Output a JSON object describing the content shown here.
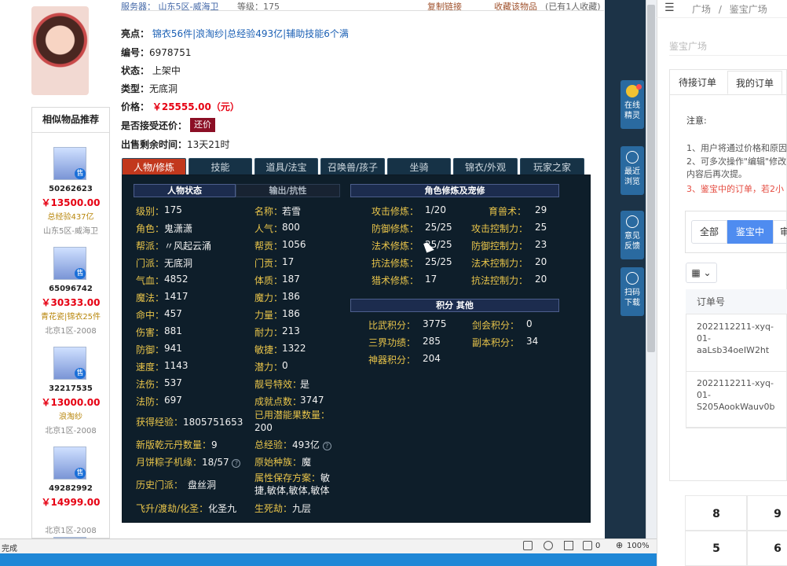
{
  "header_row": {
    "server_label": "服务器：",
    "server_value": "山东5区-威海卫",
    "rank_fragment": "等级：175",
    "link1": "复制链接",
    "link2": "收藏该物品",
    "link3": "(已有1人收藏)"
  },
  "item": {
    "highlight_label": "亮点：",
    "highlights": [
      "锦衣56件",
      "浪淘纱",
      "总经验493亿",
      "辅助技能6个满"
    ],
    "id_label": "编号：",
    "id_value": "6978751",
    "status_label": "状态：",
    "status_value": "上架中",
    "type_label": "类型：",
    "type_value": "无底洞",
    "price_label": "价格：",
    "price_value": "￥25555.00（元）",
    "counter_label": "是否接受还价：",
    "counter_button": "还价",
    "remain_label": "出售剩余时间：",
    "remain_value": "13天21时"
  },
  "tabs": [
    {
      "label": "人物/修炼"
    },
    {
      "label": "技能"
    },
    {
      "label": "道具/法宝"
    },
    {
      "label": "召唤兽/孩子"
    },
    {
      "label": "坐骑"
    },
    {
      "label": "锦衣/外观"
    },
    {
      "label": "玩家之家"
    }
  ],
  "panel": {
    "subtab_left": "人物状态",
    "subtab_right": "输出/抗性",
    "stats_left": [
      {
        "k": "级别：",
        "v": "175"
      },
      {
        "k": "角色：",
        "v": "鬼潇潇"
      },
      {
        "k": "帮派：",
        "v": "〃风起云涌"
      },
      {
        "k": "门派：",
        "v": "无底洞"
      },
      {
        "k": "气血：",
        "v": "4852"
      },
      {
        "k": "魔法：",
        "v": "1417"
      },
      {
        "k": "命中：",
        "v": "457"
      },
      {
        "k": "伤害：",
        "v": "881"
      },
      {
        "k": "防御：",
        "v": "941"
      },
      {
        "k": "速度：",
        "v": "1143"
      },
      {
        "k": "法伤：",
        "v": "537"
      },
      {
        "k": "法防：",
        "v": "697"
      }
    ],
    "stats_right": [
      {
        "k": "名称：",
        "v": "若雪"
      },
      {
        "k": "人气：",
        "v": "800"
      },
      {
        "k": "帮贡：",
        "v": "1056"
      },
      {
        "k": "门贡：",
        "v": "17"
      },
      {
        "k": "体质：",
        "v": "187"
      },
      {
        "k": "魔力：",
        "v": "186"
      },
      {
        "k": "力量：",
        "v": "186"
      },
      {
        "k": "耐力：",
        "v": "213"
      },
      {
        "k": "敏捷：",
        "v": "1322"
      },
      {
        "k": "潜力：",
        "v": "0"
      },
      {
        "k": "靓号特效：",
        "v": "是"
      },
      {
        "k": "成就点数：",
        "v": "3747"
      }
    ],
    "extra": {
      "exp_label": "获得经验：",
      "exp_value": "1805751653",
      "potential_label": "已用潜能果数量：",
      "potential_value": "200",
      "qiankun_label": "新版乾元丹数量：",
      "qiankun_value": "9",
      "total_exp_label": "总经验：",
      "total_exp_value": "493亿",
      "zongzi_label": "月饼粽子机缘：",
      "zongzi_value": "18/57",
      "race_label": "原始种族：",
      "race_value": "魔",
      "history_label": "历史门派：",
      "history_value": "盘丝洞",
      "attr_label": "属性保存方案：",
      "attr_value1": "敏",
      "attr_value2": "捷,敏体,敏体,敏体",
      "fly_label": "飞升/渡劫/化圣：",
      "fly_value": "化圣九",
      "life_label": "生死劫：",
      "life_value": "九层"
    },
    "cultivation_title": "角色修炼及宠修",
    "cultivation": [
      {
        "k": "攻击修炼：",
        "v": "1/20",
        "k2": "育兽术：",
        "v2": "29"
      },
      {
        "k": "防御修炼：",
        "v": "25/25",
        "k2": "攻击控制力：",
        "v2": "25"
      },
      {
        "k": "法术修炼：",
        "v": "25/25",
        "k2": "防御控制力：",
        "v2": "23"
      },
      {
        "k": "抗法修炼：",
        "v": "25/25",
        "k2": "法术控制力：",
        "v2": "20"
      },
      {
        "k": "猎术修炼：",
        "v": "17",
        "k2": "抗法控制力：",
        "v2": "20"
      }
    ],
    "score_title": "积分 其他",
    "scores": [
      {
        "k": "比武积分：",
        "v": "3775",
        "k2": "剑会积分：",
        "v2": "0"
      },
      {
        "k": "三界功绩：",
        "v": "285",
        "k2": "副本积分：",
        "v2": "34"
      },
      {
        "k": "神器积分：",
        "v": "204",
        "k2": "",
        "v2": ""
      }
    ]
  },
  "recommend": {
    "title": "相似物品推荐",
    "items": [
      {
        "id": "50262623",
        "price": "￥13500.00",
        "tag": "总经验437亿",
        "server": "山东5区-威海卫"
      },
      {
        "id": "65096742",
        "price": "￥30333.00",
        "tag": "青花瓷|锦衣25件",
        "server": "北京1区-2008"
      },
      {
        "id": "32217535",
        "price": "￥13000.00",
        "tag": "浪淘纱",
        "server": "北京1区-2008"
      },
      {
        "id": "49282992",
        "price": "￥14999.00",
        "tag": "",
        "server": "北京1区-2008"
      }
    ],
    "sold_badge": "售"
  },
  "side_tools": [
    {
      "l1": "在线",
      "l2": "精灵"
    },
    {
      "l1": "最近",
      "l2": "浏览"
    },
    {
      "l1": "意见",
      "l2": "反馈"
    },
    {
      "l1": "扫码",
      "l2": "下载"
    }
  ],
  "statusbar": {
    "left": "完成",
    "zoom": "100%",
    "count": "0"
  },
  "right_app": {
    "breadcrumb1": "广场",
    "breadcrumb_sep": "/",
    "breadcrumb2": "鉴宝广场",
    "title": "鉴宝广场",
    "tab1": "待接订单",
    "tab2": "我的订单",
    "note_title": "注意:",
    "note1": "1、用户将通过价格和原因",
    "note2": "2、可多次操作\"编辑\"修改",
    "note2b": "内容后再次提。",
    "note3": "3、鉴宝中的订单，若2小",
    "filter_all": "全部",
    "filter_active": "鉴宝中",
    "filter_3": "审",
    "table_head": "订单号",
    "rows": [
      {
        "l1": "2022112211-xyq-",
        "l2": "01-",
        "l3": "aaLsb34oeIW2ht"
      },
      {
        "l1": "2022112211-xyq-",
        "l2": "01-",
        "l3": "S205AookWauv0b"
      }
    ],
    "numpad": [
      "8",
      "9",
      "5",
      "6"
    ]
  }
}
